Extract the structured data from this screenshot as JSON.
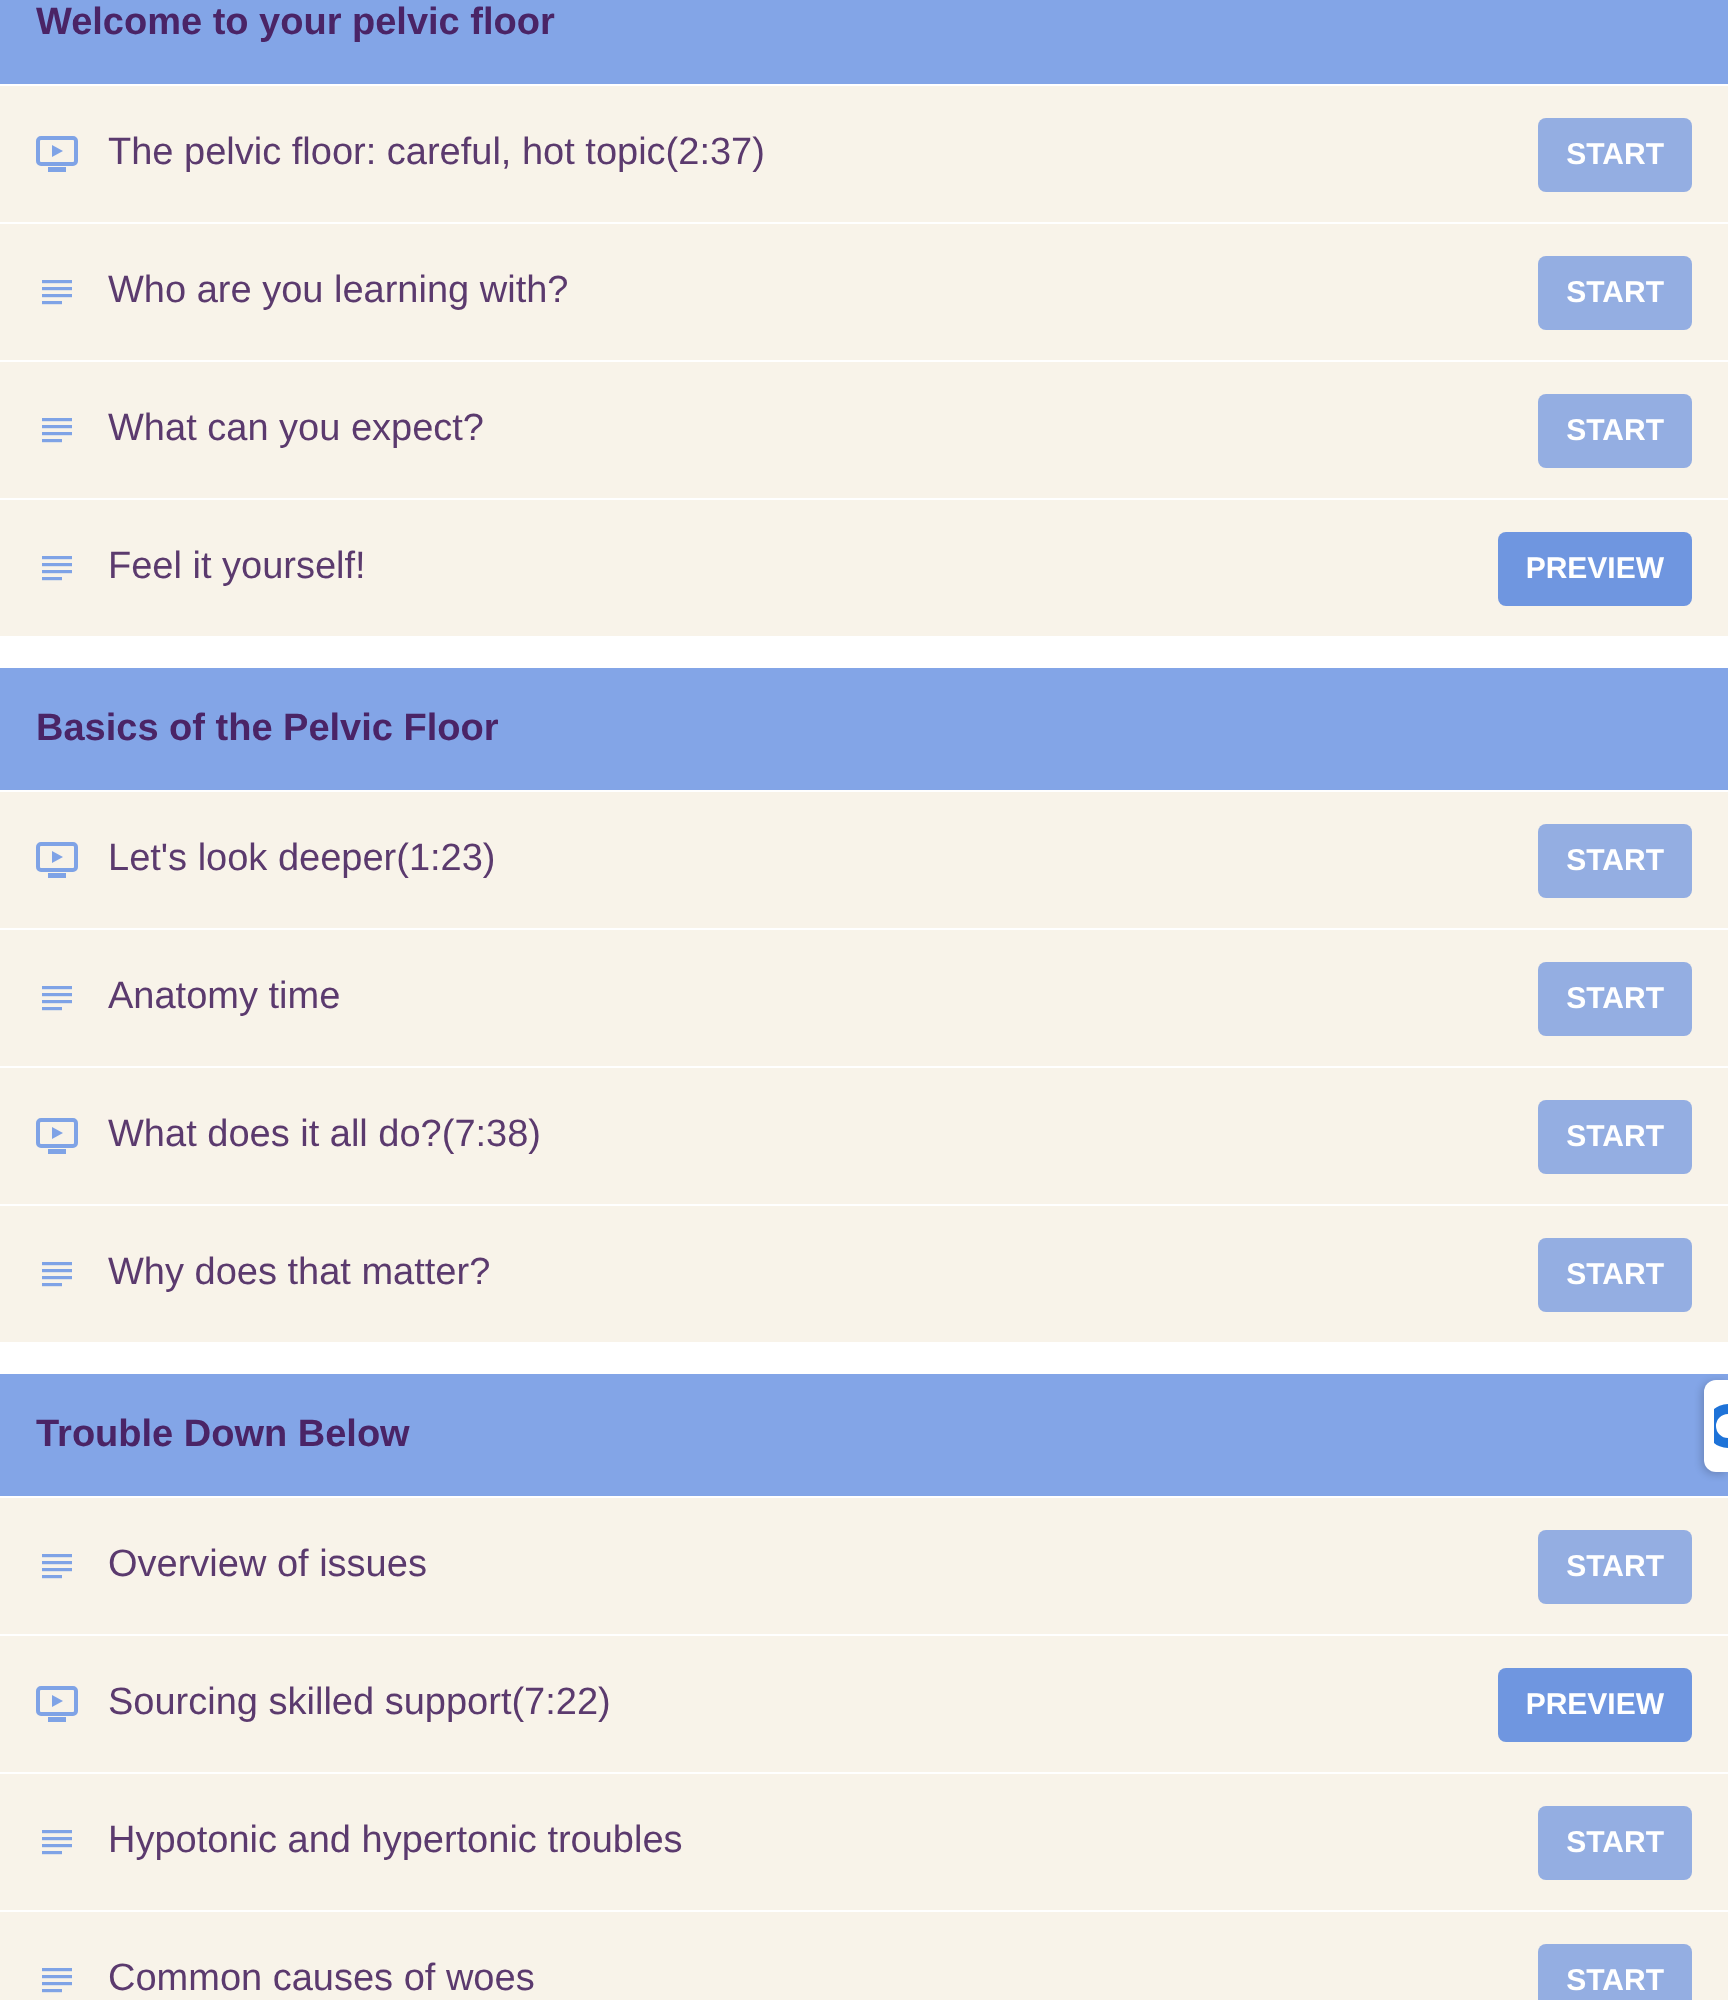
{
  "sections": [
    {
      "title": "Welcome to your pelvic floor",
      "lessons": [
        {
          "kind": "video",
          "title": "The pelvic floor: careful, hot topic(2:37)",
          "button": {
            "label": "START",
            "disabled": true
          }
        },
        {
          "kind": "text",
          "title": "Who are you learning with?",
          "button": {
            "label": "START",
            "disabled": true
          }
        },
        {
          "kind": "text",
          "title": "What can you expect?",
          "button": {
            "label": "START",
            "disabled": true
          }
        },
        {
          "kind": "text",
          "title": "Feel it yourself!",
          "button": {
            "label": "PREVIEW",
            "disabled": false
          }
        }
      ]
    },
    {
      "title": "Basics of the Pelvic Floor",
      "lessons": [
        {
          "kind": "video",
          "title": "Let's look deeper(1:23)",
          "button": {
            "label": "START",
            "disabled": true
          }
        },
        {
          "kind": "text",
          "title": "Anatomy time",
          "button": {
            "label": "START",
            "disabled": true
          }
        },
        {
          "kind": "video",
          "title": "What does it all do?(7:38)",
          "button": {
            "label": "START",
            "disabled": true
          }
        },
        {
          "kind": "text",
          "title": "Why does that matter?",
          "button": {
            "label": "START",
            "disabled": true
          }
        }
      ]
    },
    {
      "title": "Trouble Down Below",
      "lessons": [
        {
          "kind": "text",
          "title": "Overview of issues",
          "button": {
            "label": "START",
            "disabled": true
          }
        },
        {
          "kind": "video",
          "title": "Sourcing skilled support(7:22)",
          "button": {
            "label": "PREVIEW",
            "disabled": false
          }
        },
        {
          "kind": "text",
          "title": "Hypotonic and hypertonic troubles",
          "button": {
            "label": "START",
            "disabled": true
          }
        },
        {
          "kind": "text",
          "title": "Common causes of woes",
          "button": {
            "label": "START",
            "disabled": true
          }
        }
      ]
    }
  ]
}
